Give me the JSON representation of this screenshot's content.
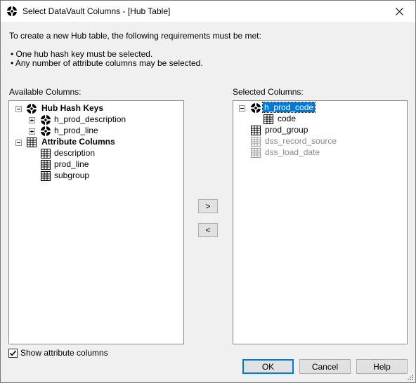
{
  "window": {
    "title": "Select DataVault Columns - [Hub Table]"
  },
  "intro": {
    "text": "To create a new Hub table, the following requirements must be met:",
    "requirements": [
      "• One hub hash key must be selected.",
      "• Any number of attribute columns may be selected."
    ]
  },
  "available": {
    "label": "Available Columns:",
    "hub_group_label": "Hub Hash Keys",
    "hub_items": [
      "h_prod_description",
      "h_prod_line"
    ],
    "attr_group_label": "Attribute Columns",
    "attr_items": [
      "description",
      "prod_line",
      "subgroup"
    ]
  },
  "selected": {
    "label": "Selected Columns:",
    "hub_key": "h_prod_code",
    "hub_child": "code",
    "columns": [
      "prod_group"
    ],
    "system_columns": [
      "dss_record_source",
      "dss_load_date"
    ]
  },
  "buttons": {
    "add": ">",
    "remove": "<",
    "ok": "OK",
    "cancel": "Cancel",
    "help": "Help"
  },
  "options": {
    "show_attribute_columns_label": "Show attribute columns",
    "show_attribute_columns_checked": true
  },
  "icons": {
    "hub_key": "hub-key-icon",
    "table_column": "grid-column-icon",
    "close": "close-icon"
  },
  "colors": {
    "selection": "#0078d7",
    "disabled_text": "#8a8a8a"
  }
}
